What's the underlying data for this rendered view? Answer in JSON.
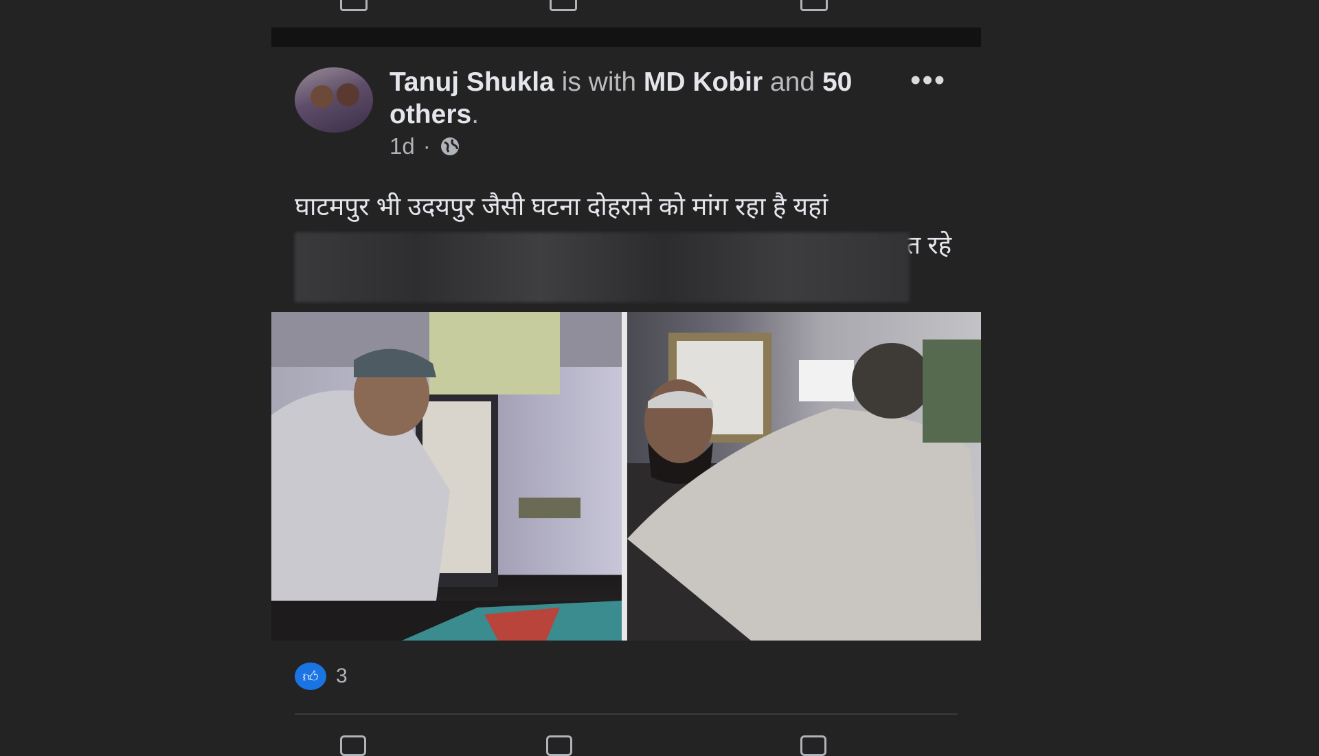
{
  "post": {
    "author": "Tanuj Shukla",
    "with_text": "is with",
    "tagged": "MD Kobir",
    "and_text": "and",
    "others": "50 others",
    "period": ".",
    "time": "1d",
    "dot": "·",
    "privacy_icon": "globe-icon",
    "more_label": "•••",
    "text_line1": "घाटमपुर भी उदयपुर जैसी घटना दोहराने को मांग रहा है यहां",
    "text_line2_visible": "त रहे",
    "like_count": "3"
  },
  "colors": {
    "background": "#232324",
    "like_blue": "#1b74e4",
    "text_primary": "#e4e6eb",
    "text_secondary": "#b0b3b8"
  }
}
